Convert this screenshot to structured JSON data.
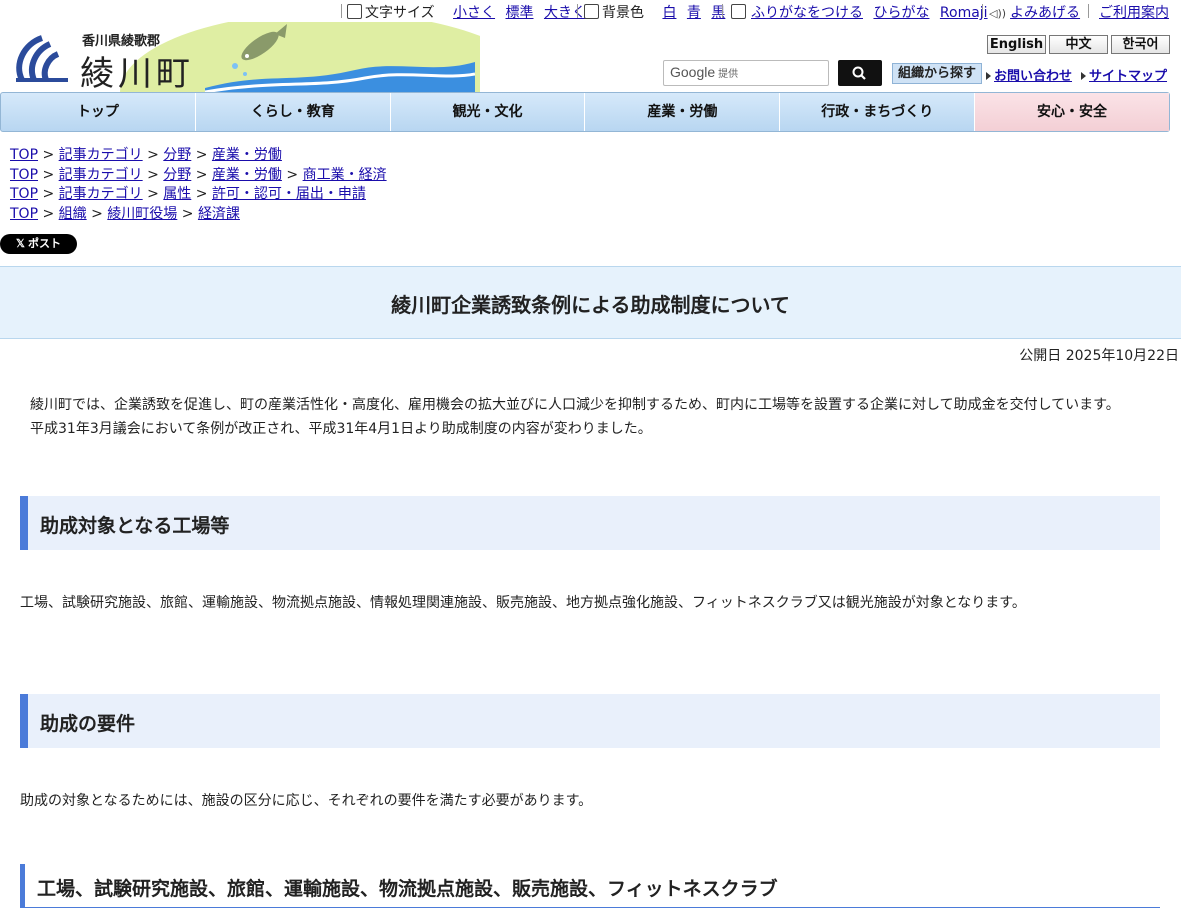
{
  "topbar": {
    "font_size_label": "文字サイズ",
    "font_small": "小さく",
    "font_standard": "標準",
    "font_large": "大きく",
    "bgcolor_label": "背景色",
    "bg_white": "白",
    "bg_blue": "青",
    "bg_black": "黒",
    "furigana_on": "ふりがなをつける",
    "hiragana": "ひらがな",
    "romaji": "Romaji",
    "read_aloud": "よみあげる",
    "guide": "ご利用案内"
  },
  "header": {
    "prefecture": "香川県綾歌郡",
    "town_name": "綾川町",
    "languages": [
      "English",
      "中文",
      "한국어"
    ],
    "search_placeholder": "Google",
    "search_provided": "提供",
    "org_search": "組織から探す",
    "contact": "お問い合わせ",
    "sitemap": "サイトマップ"
  },
  "nav": [
    "トップ",
    "くらし・教育",
    "観光・文化",
    "産業・労働",
    "行政・まちづくり",
    "安心・安全"
  ],
  "breadcrumbs": [
    [
      "TOP",
      "記事カテゴリ",
      "分野",
      "産業・労働"
    ],
    [
      "TOP",
      "記事カテゴリ",
      "分野",
      "産業・労働",
      "商工業・経済"
    ],
    [
      "TOP",
      "記事カテゴリ",
      "属性",
      "許可・認可・届出・申請"
    ],
    [
      "TOP",
      "組織",
      "綾川町役場",
      "経済課"
    ]
  ],
  "post_button": "ポスト",
  "article": {
    "title": "綾川町企業誘致条例による助成制度について",
    "published": "公開日 2025年10月22日",
    "intro_1": "綾川町では、企業誘致を促進し、町の産業活性化・高度化、雇用機会の拡大並びに人口減少を抑制するため、町内に工場等を設置する企業に対して助成金を交付しています。",
    "intro_2": "平成31年3月議会において条例が改正され、平成31年4月1日より助成制度の内容が変わりました。",
    "section1_heading": "助成対象となる工場等",
    "section1_text": "工場、試験研究施設、旅館、運輸施設、物流拠点施設、情報処理関連施設、販売施設、地方拠点強化施設、フィットネスクラブ又は観光施設が対象となります。",
    "section2_heading": "助成の要件",
    "section2_text": "助成の対象となるためには、施設の区分に応じ、それぞれの要件を満たす必要があります。",
    "section3_heading": "工場、試験研究施設、旅館、運輸施設、物流拠点施設、販売施設、フィットネスクラブ"
  },
  "colors": {
    "accent": "#4b7bd9",
    "nav_bg": "#c7def4",
    "title_band": "#e6f2fc",
    "safety_tab": "#f6d7dc"
  }
}
